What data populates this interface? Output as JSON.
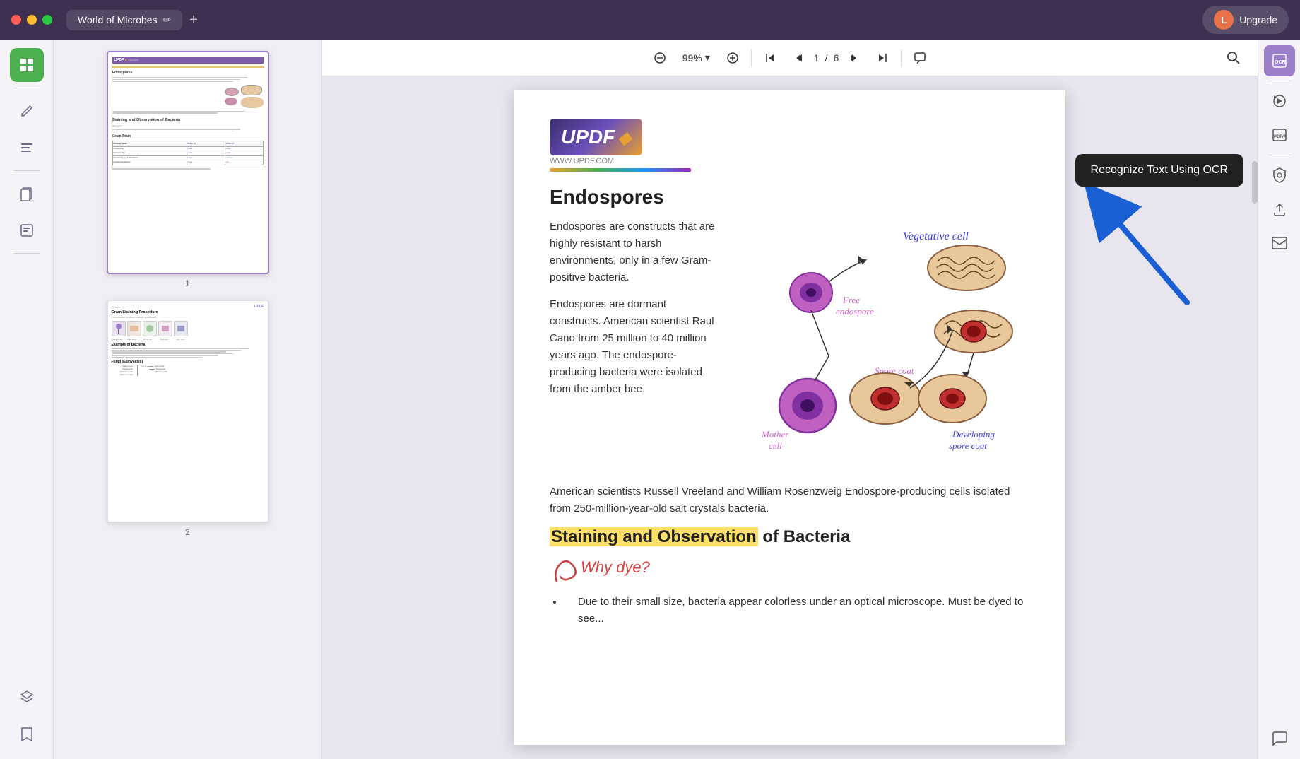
{
  "titlebar": {
    "tab_title": "World of Microbes",
    "edit_icon": "✏️",
    "add_icon": "+",
    "upgrade_label": "Upgrade",
    "avatar_letter": "L"
  },
  "toolbar": {
    "zoom_out_label": "−",
    "zoom_in_label": "+",
    "zoom_value": "99%",
    "zoom_arrow": "▾",
    "page_current": "1",
    "page_separator": "/",
    "page_total": "6",
    "first_page_icon": "⏮",
    "prev_page_icon": "⌃",
    "next_page_icon": "⌄",
    "last_page_icon": "⏭",
    "comment_icon": "💬",
    "search_icon": "🔍"
  },
  "left_sidebar": {
    "items": [
      {
        "id": "thumbnails",
        "icon": "▦",
        "active": true
      },
      {
        "id": "divider1"
      },
      {
        "id": "edit",
        "icon": "✏"
      },
      {
        "id": "annotate",
        "icon": "☰"
      },
      {
        "id": "divider2"
      },
      {
        "id": "pages",
        "icon": "⊞"
      },
      {
        "id": "forms",
        "icon": "◧"
      },
      {
        "id": "divider3"
      },
      {
        "id": "layers",
        "icon": "⊗",
        "bottom": true
      },
      {
        "id": "bookmark",
        "icon": "🔖",
        "bottom": true
      }
    ]
  },
  "right_sidebar": {
    "items": [
      {
        "id": "ocr",
        "label": "OCR",
        "active": true
      },
      {
        "id": "divider1"
      },
      {
        "id": "convert",
        "icon": "⟳"
      },
      {
        "id": "pdf",
        "label": "PDF/A"
      },
      {
        "id": "divider2"
      },
      {
        "id": "secure",
        "icon": "🔒"
      },
      {
        "id": "upload",
        "icon": "↑"
      },
      {
        "id": "mail",
        "icon": "✉"
      },
      {
        "id": "chat",
        "icon": "💬",
        "bottom": true
      }
    ]
  },
  "ocr_tooltip": {
    "label": "Recognize Text Using OCR"
  },
  "doc": {
    "updf_logo": "UPDF",
    "updf_website": "WWW.UPDF.COM",
    "section_endospores": "Endospores",
    "para1": "Endospores are constructs that are highly resistant to harsh environments, only in a few Gram-positive bacteria.",
    "para2": "Endospores are dormant constructs. American scientist Raul Cano from 25 million to 40 million years ago. The endospore-producing bacteria were isolated from the amber bee.",
    "para3": "American scientists Russell Vreeland and William Rosenzweig Endospore-producing cells isolated from 250-million-year-old salt crystals bacteria.",
    "section_staining_part1": "Staining and Observation",
    "section_staining_part2": " of Bacteria",
    "why_dye": "Why dye?",
    "bullet1": "Due to their small size, bacteria appear colorless under an optical microscope. Must be dyed to see...",
    "diagram_labels": {
      "vegetative_cell": "Vegetative cell",
      "free_endospore": "Free endospore",
      "spore_coat": "Spore coat",
      "mother_cell": "Mother cell",
      "developing_spore_coat": "Developing spore coat"
    }
  },
  "thumbnails": [
    {
      "page_num": "1"
    },
    {
      "page_num": "2"
    }
  ]
}
